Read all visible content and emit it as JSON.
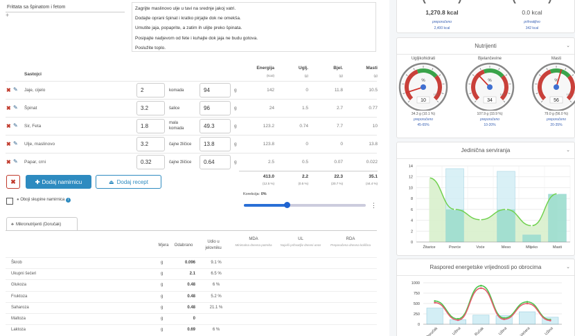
{
  "recipe": {
    "title": "Frittata sa špinatom i fetom",
    "add_symbol": "+",
    "instructions": [
      "Zagrijte maslinovo ulje u tavi na srednje jakoj vatri.",
      "Dodajte oprani špinat i kratko pirjajte dok ne omekša.",
      "Umutite jaja, popaprite, a zatim ih ulijte preko špinata.",
      "Posipajte nadjevom od fete i kuhajte dok jaja ne budu gotova.",
      "Poslužite toplo."
    ]
  },
  "ingredients_table": {
    "header_name": "Sastojci",
    "columns": [
      {
        "label": "Energija",
        "unit": "(kcal)"
      },
      {
        "label": "Uglj.",
        "unit": "(g)"
      },
      {
        "label": "Bjel.",
        "unit": "(g)"
      },
      {
        "label": "Masti",
        "unit": "(g)"
      }
    ],
    "rows": [
      {
        "name": "Jaje, cijelo",
        "qty": "2",
        "unit": "komada",
        "grams": "94",
        "g": "g",
        "energy": "142",
        "carbs": "0",
        "protein": "11.8",
        "fat": "10.5"
      },
      {
        "name": "Špinat",
        "qty": "3.2",
        "unit": "šalice",
        "grams": "96",
        "g": "g",
        "energy": "24",
        "carbs": "1.5",
        "protein": "2.7",
        "fat": "0.77"
      },
      {
        "name": "Sir, Feta",
        "qty": "1.8",
        "unit": "mala komada",
        "grams": "49.3",
        "g": "g",
        "energy": "123.2",
        "carbs": "0.74",
        "protein": "7.7",
        "fat": "10"
      },
      {
        "name": "Ulje, maslinovo",
        "qty": "3.2",
        "unit": "čajne žličice",
        "grams": "13.8",
        "g": "g",
        "energy": "123.8",
        "carbs": "0",
        "protein": "0",
        "fat": "13.8"
      },
      {
        "name": "Papar, crni",
        "qty": "0.32",
        "unit": "čajne žličice",
        "grams": "0.64",
        "g": "g",
        "energy": "2.5",
        "carbs": "0.5",
        "protein": "0.07",
        "fat": "0.022"
      }
    ],
    "totals": {
      "energy": "413.0",
      "carbs": "2.2",
      "protein": "22.3",
      "fat": "35.1"
    },
    "totals_pct": {
      "energy": "(12.5 %)",
      "carbs": "(0.5 %)",
      "protein": "(20.7 %)",
      "fat": "(44.4 %)"
    }
  },
  "icons": {
    "delete": "x-icon",
    "edit": "pencil-icon",
    "cancel": "x-icon",
    "plus": "plus-icon",
    "upload": "upload-icon",
    "info": "info-icon",
    "menu": "kebab-icon",
    "chevron": "chevron-down-icon"
  },
  "actions": {
    "cancel_symbol": "✖",
    "add_ingredient": "Dodaj namirnicu",
    "add_recipe": "Dodaj recept",
    "group_check_label": "Oboji skupine namirnica"
  },
  "slider": {
    "label": "Korekcija:",
    "value": "0%",
    "fraction": 0.35
  },
  "micronutrients": {
    "tab_label": "Mikronutrijenti (Doručak)",
    "headers": {
      "unit": "Mjera",
      "amount": "Odabrano",
      "share": "Udio u jelovniku",
      "mda": "MDA",
      "mda_sub": "Minimalna dnevna potreba",
      "ul": "UL",
      "ul_sub": "Najviši prihvatljiv dnevni unos",
      "rda": "RDA",
      "rda_sub": "Preporučena dnevna količina"
    },
    "rows": [
      {
        "name": "Škrob",
        "unit": "g",
        "amount": "0.096",
        "pct": "9.1 %"
      },
      {
        "name": "Ukupni šećeri",
        "unit": "g",
        "amount": "2.1",
        "pct": "6.5 %"
      },
      {
        "name": "Glukoza",
        "unit": "g",
        "amount": "0.48",
        "pct": "6 %"
      },
      {
        "name": "Fruktoza",
        "unit": "g",
        "amount": "0.48",
        "pct": "5.2 %"
      },
      {
        "name": "Saharoza",
        "unit": "g",
        "amount": "0.48",
        "pct": "21.1 %"
      },
      {
        "name": "Maltoza",
        "unit": "g",
        "amount": "0",
        "pct": ""
      },
      {
        "name": "Laktoza",
        "unit": "g",
        "amount": "0.69",
        "pct": "6 %"
      }
    ]
  },
  "energy_summary": {
    "left": {
      "value": "1,270.8 kcal",
      "label": "preporučeno",
      "target": "2,400 kcal"
    },
    "right": {
      "value": "0.0 kcal",
      "label": "prihvatljivo",
      "target": "342 kcal"
    }
  },
  "nutrients_panel": {
    "title": "Nutrijenti",
    "gauges": [
      {
        "name": "Ugljikohidrati",
        "value": 10,
        "reading": "10",
        "amount": "34.3 g (10.1 %)",
        "label": "preporučeno",
        "range": "45-65%"
      },
      {
        "name": "Bjelančevine",
        "value": 34,
        "reading": "34",
        "amount": "107.9 g (33.9 %)",
        "label": "preporučeno",
        "range": "10-20%"
      },
      {
        "name": "Masti",
        "value": 56,
        "reading": "56",
        "amount": "79.0 g (56.0 %)",
        "label": "preporučeno",
        "range": "20-35%"
      }
    ],
    "gauge_symbol": "%",
    "gauge_max": "100"
  },
  "serving_chart": {
    "title": "Jedinična serviranja"
  },
  "energy_meal_chart": {
    "title": "Raspored energetske vrijednosti po obrocima"
  },
  "chart_data": [
    {
      "type": "bar",
      "title": "Jedinična serviranja",
      "categories": [
        "Žitarice",
        "Povrće",
        "Voće",
        "Meso",
        "Mlijeko",
        "Masti"
      ],
      "series": [
        {
          "type": "bar",
          "values": [
            0,
            13.5,
            0,
            13,
            1.3,
            8.8
          ]
        },
        {
          "type": "area",
          "values": [
            11.8,
            6.0,
            4.1,
            6.0,
            3.0,
            8.9
          ]
        }
      ],
      "ylim": [
        0,
        14
      ],
      "yticks": [
        0,
        2,
        4,
        6,
        8,
        10,
        12,
        14
      ],
      "colors": {
        "bar_fill": "#d3eef5",
        "bar_stroke": "#9acfe0",
        "bar_overlap": "#8fd8c3",
        "area_fill": "#d8f0cc",
        "line": "#71d14f"
      },
      "grid": true
    },
    {
      "type": "line",
      "title": "Raspored energetske vrijednosti po obrocima",
      "yticks": [
        0,
        250,
        500,
        750,
        1000
      ],
      "ylim": [
        0,
        1000
      ],
      "bars": [
        390,
        110,
        220,
        210,
        300,
        170
      ],
      "series": [
        {
          "color": "#4cc34c",
          "values": [
            560,
            130,
            930,
            150,
            540,
            110
          ]
        },
        {
          "color": "#e45b6c",
          "values": [
            520,
            100,
            870,
            120,
            500,
            90
          ]
        }
      ],
      "x_labels": [
        "Doručak",
        "Užina",
        "Ručak",
        "Užina",
        "Večera",
        "Užina"
      ],
      "grid": true
    }
  ]
}
